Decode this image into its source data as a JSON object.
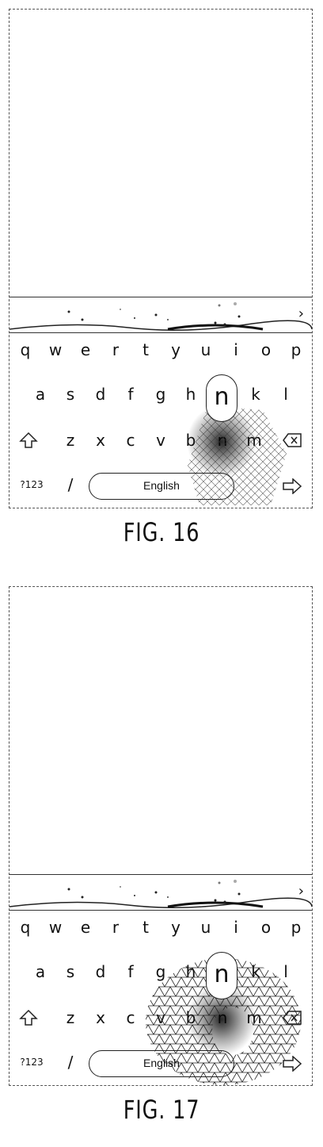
{
  "figures": [
    {
      "caption": "FIG. 16",
      "keyboard": {
        "row1": [
          "q",
          "w",
          "e",
          "r",
          "t",
          "y",
          "u",
          "i",
          "o",
          "p"
        ],
        "row2": [
          "a",
          "s",
          "d",
          "f",
          "g",
          "h",
          "n",
          "k",
          "l"
        ],
        "row3": [
          "z",
          "x",
          "c",
          "v",
          "b",
          "n",
          "m"
        ],
        "row4": {
          "symbols": "?123",
          "slash": "/",
          "space": "English"
        },
        "popup_key": "n"
      },
      "overlay": "gaussian-plus-small-hatched-region"
    },
    {
      "caption": "FIG. 17",
      "keyboard": {
        "row1": [
          "q",
          "w",
          "e",
          "r",
          "t",
          "y",
          "u",
          "i",
          "o",
          "p"
        ],
        "row2": [
          "a",
          "s",
          "d",
          "f",
          "g",
          "h",
          "n",
          "k",
          "l"
        ],
        "row3": [
          "z",
          "x",
          "c",
          "v",
          "b",
          "n",
          "m"
        ],
        "row4": {
          "symbols": "?123",
          "slash": "/",
          "space": "English"
        },
        "popup_key": "n"
      },
      "overlay": "gaussian-plus-large-hatched-region"
    }
  ],
  "icons": {
    "shift": "shift-arrow-icon",
    "backspace": "backspace-icon",
    "enter": "enter-arrow-icon",
    "chevron": "chevron-right-icon"
  }
}
